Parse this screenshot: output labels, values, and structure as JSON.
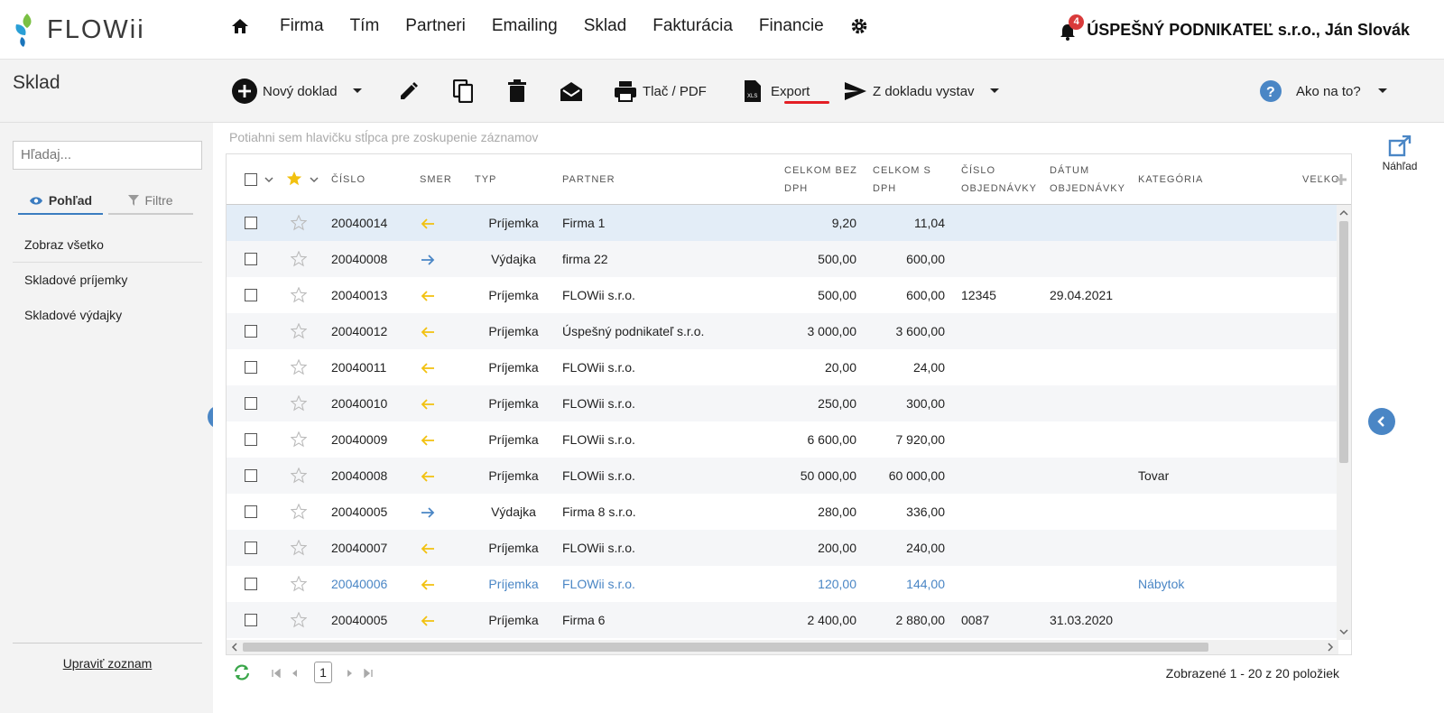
{
  "brand": {
    "name": "FLOWii"
  },
  "nav": {
    "items": [
      "Firma",
      "Tím",
      "Partneri",
      "Emailing",
      "Sklad",
      "Fakturácia",
      "Financie"
    ]
  },
  "user": {
    "notifications": "4",
    "company": "ÚSPEŠNÝ PODNIKATEĽ s.r.o., Ján Slovák"
  },
  "module": {
    "title": "Sklad"
  },
  "toolbar": {
    "new_doc": "Nový doklad",
    "print": "Tlač / PDF",
    "export": "Export",
    "issue_from": "Z dokladu vystav",
    "help": "Ako na to?"
  },
  "sidebar": {
    "search_placeholder": "Hľadaj...",
    "tab_view": "Pohľad",
    "tab_filters": "Filtre",
    "items": [
      "Zobraz všetko",
      "Skladové príjemky",
      "Skladové výdajky"
    ],
    "edit_list": "Upraviť zoznam"
  },
  "grid": {
    "group_hint": "Potiahni sem hlavičku stĺpca pre zoskupenie záznamov",
    "headers": {
      "number": "ČÍSLO",
      "direction": "SMER",
      "type": "TYP",
      "partner": "PARTNER",
      "total_ex": "CELKOM BEZ DPH",
      "total_inc": "CELKOM S DPH",
      "order_no": "ČÍSLO OBJEDNÁVKY",
      "order_date": "DÁTUM OBJEDNÁVKY",
      "category": "KATEGÓRIA",
      "more": "VEĽKO"
    },
    "rows": [
      {
        "num": "20040014",
        "dir": "in",
        "type": "Príjemka",
        "partner": "Firma 1",
        "ex": "9,20",
        "inc": "11,04",
        "ord": "",
        "date": "",
        "cat": ""
      },
      {
        "num": "20040008",
        "dir": "out",
        "type": "Výdajka",
        "partner": "firma 22",
        "ex": "500,00",
        "inc": "600,00",
        "ord": "",
        "date": "",
        "cat": ""
      },
      {
        "num": "20040013",
        "dir": "in",
        "type": "Príjemka",
        "partner": "FLOWii s.r.o.",
        "ex": "500,00",
        "inc": "600,00",
        "ord": "12345",
        "date": "29.04.2021",
        "cat": ""
      },
      {
        "num": "20040012",
        "dir": "in",
        "type": "Príjemka",
        "partner": "Úspešný podnikateľ s.r.o.",
        "ex": "3 000,00",
        "inc": "3 600,00",
        "ord": "",
        "date": "",
        "cat": ""
      },
      {
        "num": "20040011",
        "dir": "in",
        "type": "Príjemka",
        "partner": "FLOWii s.r.o.",
        "ex": "20,00",
        "inc": "24,00",
        "ord": "",
        "date": "",
        "cat": ""
      },
      {
        "num": "20040010",
        "dir": "in",
        "type": "Príjemka",
        "partner": "FLOWii s.r.o.",
        "ex": "250,00",
        "inc": "300,00",
        "ord": "",
        "date": "",
        "cat": ""
      },
      {
        "num": "20040009",
        "dir": "in",
        "type": "Príjemka",
        "partner": "FLOWii s.r.o.",
        "ex": "6 600,00",
        "inc": "7 920,00",
        "ord": "",
        "date": "",
        "cat": ""
      },
      {
        "num": "20040008",
        "dir": "in",
        "type": "Príjemka",
        "partner": "FLOWii s.r.o.",
        "ex": "50 000,00",
        "inc": "60 000,00",
        "ord": "",
        "date": "",
        "cat": "Tovar"
      },
      {
        "num": "20040005",
        "dir": "out",
        "type": "Výdajka",
        "partner": "Firma 8 s.r.o.",
        "ex": "280,00",
        "inc": "336,00",
        "ord": "",
        "date": "",
        "cat": ""
      },
      {
        "num": "20040007",
        "dir": "in",
        "type": "Príjemka",
        "partner": "FLOWii s.r.o.",
        "ex": "200,00",
        "inc": "240,00",
        "ord": "",
        "date": "",
        "cat": ""
      },
      {
        "num": "20040006",
        "dir": "in",
        "type": "Príjemka",
        "partner": "FLOWii s.r.o.",
        "ex": "120,00",
        "inc": "144,00",
        "ord": "",
        "date": "",
        "cat": "Nábytok"
      },
      {
        "num": "20040005",
        "dir": "in",
        "type": "Príjemka",
        "partner": "Firma 6",
        "ex": "2 400,00",
        "inc": "2 880,00",
        "ord": "0087",
        "date": "31.03.2020",
        "cat": ""
      }
    ]
  },
  "pager": {
    "page": "1",
    "info": "Zobrazené 1 - 20 z 20 položiek"
  },
  "preview": {
    "label": "Náhľad"
  },
  "colors": {
    "accent": "#4a86c5",
    "in_arrow": "#f2c10f",
    "out_arrow": "#4a86c5",
    "export_underline": "#e31e24",
    "badge": "#d93a3a"
  }
}
